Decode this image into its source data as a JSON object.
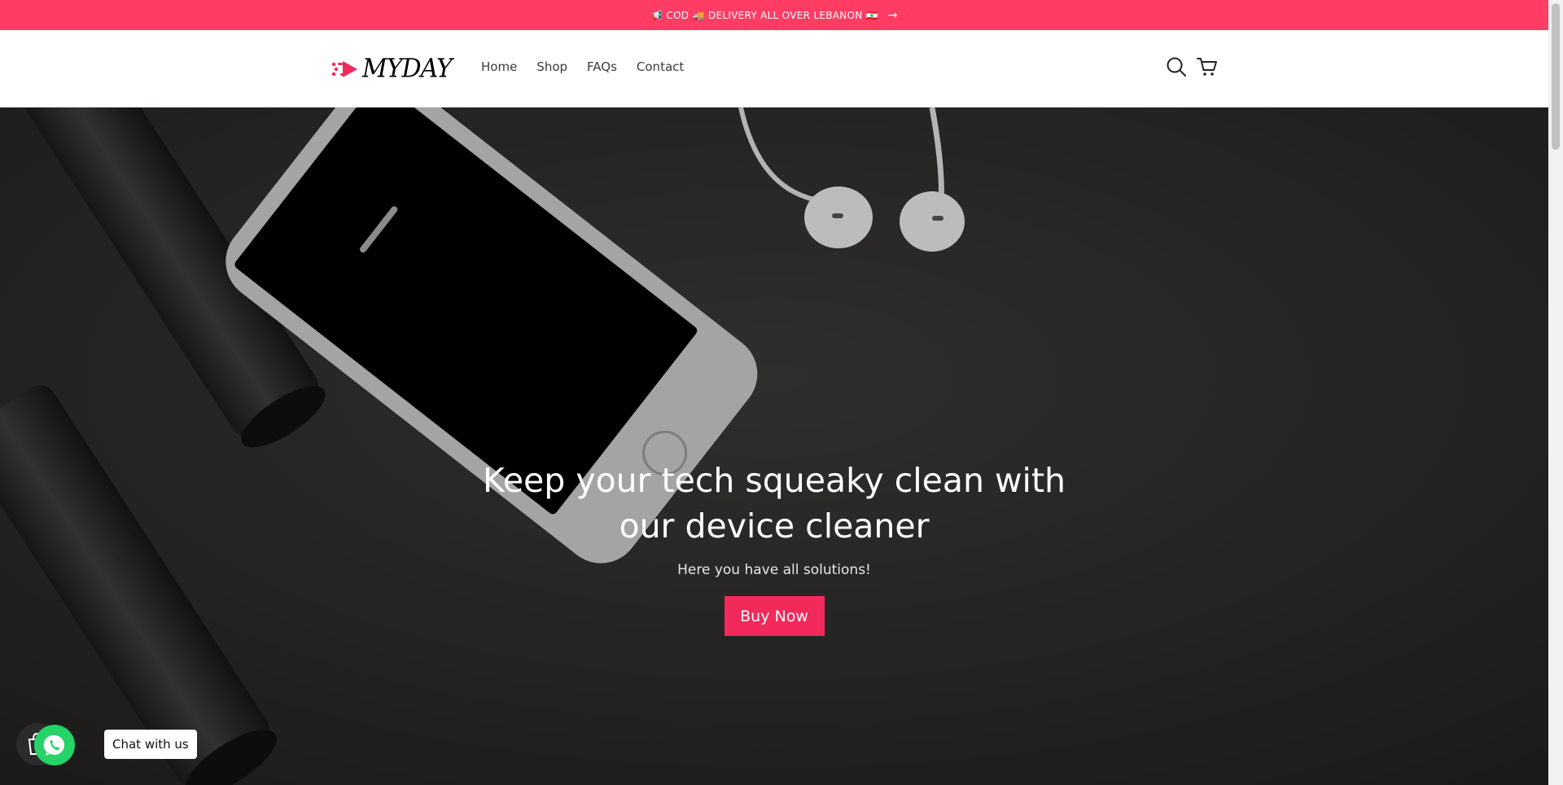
{
  "announcement": {
    "text": "📢 COD 🚚 DELIVERY ALL OVER LEBANON 🇱🇧",
    "arrow": "→",
    "background": "#ff3c64"
  },
  "header": {
    "logo_text": "MYDAY",
    "nav": [
      "Home",
      "Shop",
      "FAQs",
      "Contact"
    ],
    "icons": [
      "search-icon",
      "cart-icon"
    ]
  },
  "hero": {
    "title": "Keep your tech squeaky clean with our device cleaner",
    "subtitle": "Here you have all solutions!",
    "button_label": "Buy Now",
    "button_color": "#f2295b"
  },
  "chat": {
    "label": "Chat with us",
    "icon": "whatsapp-icon"
  }
}
